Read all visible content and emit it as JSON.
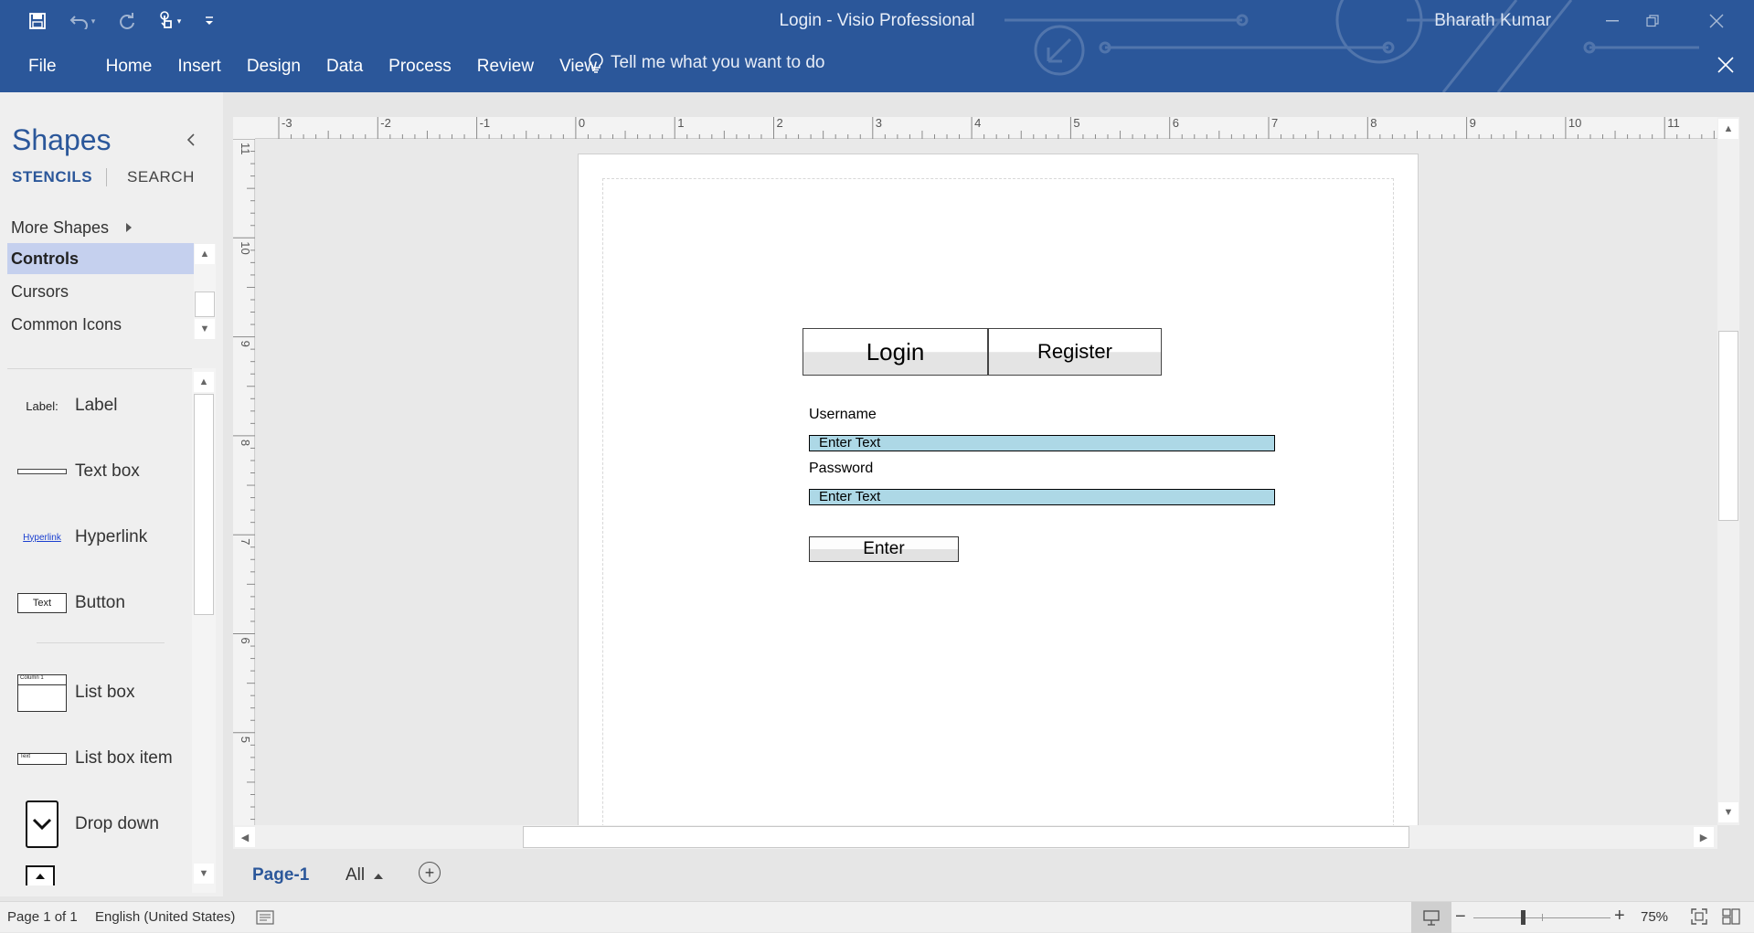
{
  "window": {
    "title": "Login - Visio Professional",
    "user": "Bharath Kumar"
  },
  "quick_access": {
    "icons": [
      "save-icon",
      "undo-icon",
      "redo-icon",
      "touch-mode-icon",
      "customize-qat-icon"
    ]
  },
  "ribbon": {
    "tabs": [
      "File",
      "Home",
      "Insert",
      "Design",
      "Data",
      "Process",
      "Review",
      "View"
    ],
    "tell_me": "Tell me what you want to do"
  },
  "shapes_pane": {
    "title": "Shapes",
    "tabs": {
      "stencils": "STENCILS",
      "search": "SEARCH"
    },
    "stencils": [
      "More Shapes",
      "Controls",
      "Cursors",
      "Common Icons"
    ],
    "active_stencil": "Controls",
    "shapes": [
      {
        "label": "Label",
        "thumb": "Label:"
      },
      {
        "label": "Text box",
        "thumb": ""
      },
      {
        "label": "Hyperlink",
        "thumb": "Hyperlink"
      },
      {
        "label": "Button",
        "thumb": "Text"
      },
      {
        "label": "List box",
        "thumb": "Column 1"
      },
      {
        "label": "List box item",
        "thumb": "Text"
      },
      {
        "label": "Drop down",
        "thumb": ""
      }
    ]
  },
  "rulers": {
    "horizontal": [
      "-3",
      "-2",
      "-1",
      "0",
      "1",
      "2",
      "3",
      "4",
      "5",
      "6",
      "7",
      "8",
      "9",
      "10",
      "11"
    ],
    "vertical": [
      "11",
      "10",
      "9",
      "8",
      "7",
      "6",
      "5"
    ]
  },
  "wireframe": {
    "tabs": {
      "login": "Login",
      "register": "Register"
    },
    "username_label": "Username",
    "username_input": "Enter Text",
    "password_label": "Password",
    "password_input": "Enter Text",
    "enter_button": "Enter"
  },
  "page_tabs": {
    "current": "Page-1",
    "all": "All"
  },
  "status_bar": {
    "page_info": "Page 1 of 1",
    "language": "English (United States)",
    "zoom": "75%"
  },
  "colors": {
    "ribbon": "#2b579a",
    "active_stencil": "#c5d0ee",
    "input_fill": "#add8e6"
  }
}
